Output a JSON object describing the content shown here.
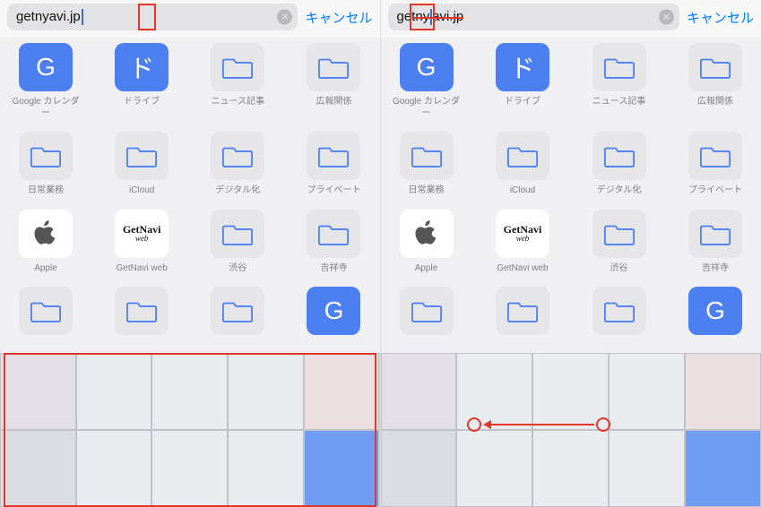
{
  "left": {
    "search": {
      "value": "getnyavi.jp",
      "cancel": "キャンセル"
    },
    "rows": [
      [
        {
          "label": "Google カレンダー",
          "icon": "blue-G"
        },
        {
          "label": "ドライブ",
          "icon": "blue-do"
        },
        {
          "label": "ニュース記事",
          "icon": "folder"
        },
        {
          "label": "広報関係",
          "icon": "folder"
        }
      ],
      [
        {
          "label": "日常業務",
          "icon": "folder"
        },
        {
          "label": "iCloud",
          "icon": "folder"
        },
        {
          "label": "デジタル化",
          "icon": "folder"
        },
        {
          "label": "プライベート",
          "icon": "folder"
        }
      ],
      [
        {
          "label": "Apple",
          "icon": "apple"
        },
        {
          "label": "GetNavi web",
          "icon": "getnavi"
        },
        {
          "label": "渋谷",
          "icon": "folder"
        },
        {
          "label": "吉祥寺",
          "icon": "folder"
        }
      ],
      [
        {
          "label": "",
          "icon": "folder"
        },
        {
          "label": "",
          "icon": "folder"
        },
        {
          "label": "",
          "icon": "folder"
        },
        {
          "label": "",
          "icon": "blue-G"
        }
      ]
    ]
  },
  "right": {
    "search": {
      "value": "getnyavi.jp",
      "cancel": "キャンセル"
    },
    "rows": [
      [
        {
          "label": "Google カレンダー",
          "icon": "blue-G"
        },
        {
          "label": "ドライブ",
          "icon": "blue-do"
        },
        {
          "label": "ニュース記事",
          "icon": "folder"
        },
        {
          "label": "広報関係",
          "icon": "folder"
        }
      ],
      [
        {
          "label": "日常業務",
          "icon": "folder"
        },
        {
          "label": "iCloud",
          "icon": "folder"
        },
        {
          "label": "デジタル化",
          "icon": "folder"
        },
        {
          "label": "プライベート",
          "icon": "folder"
        }
      ],
      [
        {
          "label": "Apple",
          "icon": "apple"
        },
        {
          "label": "GetNavi web",
          "icon": "getnavi"
        },
        {
          "label": "渋谷",
          "icon": "folder"
        },
        {
          "label": "吉祥寺",
          "icon": "folder"
        }
      ],
      [
        {
          "label": "",
          "icon": "folder"
        },
        {
          "label": "",
          "icon": "folder"
        },
        {
          "label": "",
          "icon": "folder"
        },
        {
          "label": "",
          "icon": "blue-G"
        }
      ]
    ]
  },
  "icons": {
    "G": "G",
    "do": "ド"
  },
  "getnavi": {
    "top": "GetNavi",
    "sub": "web"
  },
  "annotations": {
    "left_cursor_box": true,
    "left_keyboard_box": true,
    "right_cursor_box": true,
    "right_strike": true,
    "right_swipe_arrow": true
  },
  "colors": {
    "accent_blue": "#4c7ff0",
    "ios_link": "#007aff",
    "annotation_red": "#e3362b"
  }
}
